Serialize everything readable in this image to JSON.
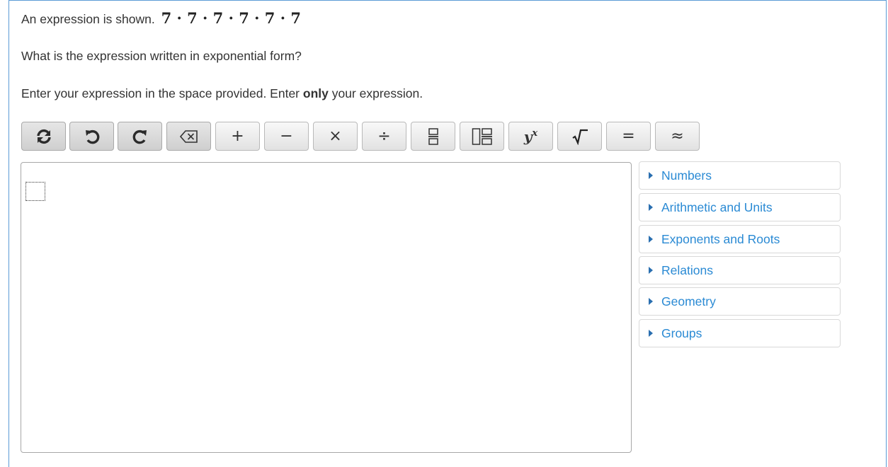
{
  "question": {
    "intro": "An expression is shown.",
    "expression": "7 · 7 · 7 · 7 · 7 · 7",
    "prompt": "What is the expression written in exponential form?",
    "instruction_before": "Enter your expression in the space provided. Enter ",
    "instruction_bold": "only",
    "instruction_after": " your expression."
  },
  "toolbar": {
    "buttons": [
      {
        "name": "refresh-icon",
        "label": ""
      },
      {
        "name": "undo-icon",
        "label": ""
      },
      {
        "name": "redo-icon",
        "label": ""
      },
      {
        "name": "backspace-icon",
        "label": ""
      },
      {
        "name": "plus",
        "label": "+"
      },
      {
        "name": "minus",
        "label": "−"
      },
      {
        "name": "times",
        "label": "×"
      },
      {
        "name": "divide",
        "label": "÷"
      },
      {
        "name": "fraction-icon",
        "label": ""
      },
      {
        "name": "mixed-fraction-icon",
        "label": ""
      },
      {
        "name": "exponent",
        "label": "y",
        "sup": "x"
      },
      {
        "name": "sqrt",
        "label": "√‾"
      },
      {
        "name": "equals",
        "label": "="
      },
      {
        "name": "approx",
        "label": "≈"
      }
    ]
  },
  "palette": {
    "items": [
      "Numbers",
      "Arithmetic and Units",
      "Exponents and Roots",
      "Relations",
      "Geometry",
      "Groups"
    ]
  },
  "colors": {
    "frame_border": "#5b9bd5",
    "palette_link": "#2a8ad4"
  }
}
